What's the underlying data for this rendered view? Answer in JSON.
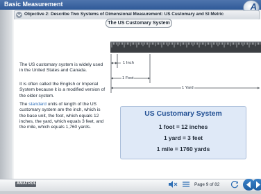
{
  "app": {
    "title": "Basic Measurement"
  },
  "objective": {
    "text": "Objective 2: Describe Two Systems of Dimensional Measurement: US Customary and SI Metric"
  },
  "section": {
    "title": "The US Customary System"
  },
  "body": {
    "p1": "The US customary system is widely used in the United States and Canada.",
    "p2": "It is often called the English or Imperial System because it is a modified version of the older system.",
    "p3_prefix": "The ",
    "p3_link": "standard",
    "p3_suffix": " units of length of the US customary system are the inch, which is the base unit, the foot, which equals 12 inches, the yard, which equals 3 feet, and the mile, which equals 1,760 yards."
  },
  "diagram": {
    "inch_label": "1 Inch",
    "foot_label": "1 Foot",
    "yard_label": "1 Yard"
  },
  "card": {
    "title": "US Customary System",
    "lines": [
      "1 foot = 12 inches",
      "1 yard = 3 feet",
      "1 mile = 1760 yards"
    ]
  },
  "footer": {
    "brand": "AMATROL",
    "page_text": "Page 9 of 82"
  },
  "colors": {
    "titlebar": "#2f5a98",
    "card_title": "#214f93",
    "link": "#2e6fba",
    "nav_button": "#1f5ea3"
  }
}
